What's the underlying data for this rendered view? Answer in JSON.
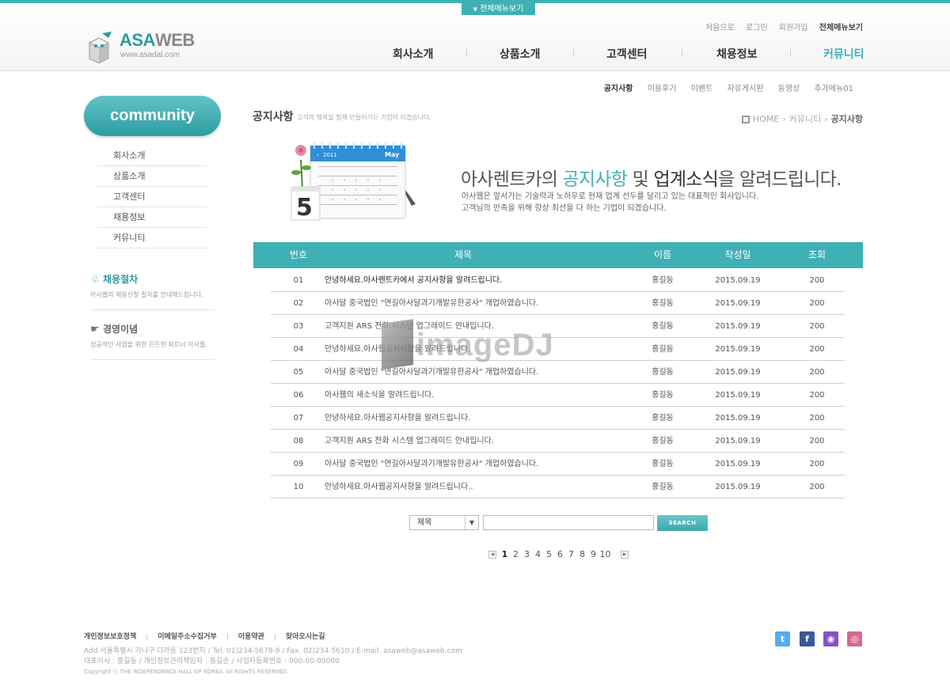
{
  "header": {
    "all_menu_tab": "전체메뉴보기",
    "logo": {
      "name_a": "ASA",
      "name_b": "WEB",
      "url": "www.asadal.com"
    },
    "util_links": [
      "처음으로",
      "로그인",
      "회원가입",
      "전체메뉴보기"
    ],
    "gnb": [
      "회사소개",
      "상품소개",
      "고객센터",
      "채용정보",
      "커뮤니티"
    ],
    "subnav": [
      "공지사항",
      "이용후기",
      "이벤트",
      "자유게시판",
      "동영상",
      "추가메뉴01"
    ]
  },
  "sidebar": {
    "badge": "community",
    "items": [
      "회사소개",
      "상품소개",
      "고객센터",
      "채용정보",
      "커뮤니티"
    ],
    "box1": {
      "title": "채용절차",
      "desc": "아사웹의 채용신청 절차를 안내해드립니다."
    },
    "box2": {
      "title": "경영이념",
      "desc": "성공적인 사업을 위한 든든한 파트너 아사웹."
    }
  },
  "content": {
    "page_title": "공지사항",
    "page_subtitle": "고객의 행복을 함께 만들어가는 기업이 되겠습니다.",
    "breadcrumb": {
      "home": "HOME",
      "section": "커뮤니티",
      "current": "공지사항"
    },
    "calendar": {
      "month": "May",
      "year": "2011",
      "day": "5"
    },
    "headline": {
      "a": "아사렌트카의 ",
      "b": "공지사항",
      "c": " 및 ",
      "d": "업계소식",
      "e": "을 알려드립니다."
    },
    "desc_lines": [
      "아사웹은 앞서가는 기술력과 노하우로 현재 업계 선두를 달리고 있는 대표적인 회사입니다.",
      "고객님의 만족을 위해 항상 최선을 다 하는 기업이 되겠습니다."
    ],
    "columns": [
      "번호",
      "제목",
      "이름",
      "작성일",
      "조회"
    ],
    "rows": [
      {
        "num": "01",
        "title": "안녕하세요.아사렌트카에서 공지사항을 알려드립니다.",
        "name": "홍길동",
        "date": "2015.09.19",
        "hits": "200"
      },
      {
        "num": "02",
        "title": "아사달 중국법인 \"연길아사달과기개발유한공사\" 개업하였습니다.",
        "name": "홍길동",
        "date": "2015.09.19",
        "hits": "200"
      },
      {
        "num": "03",
        "title": "고객지원 ARS 전화 시스템 업그레이드 안내입니다.",
        "name": "홍길동",
        "date": "2015.09.19",
        "hits": "200"
      },
      {
        "num": "04",
        "title": "안녕하세요.아사웹공지사항을 알려드립니다.",
        "name": "홍길동",
        "date": "2015.09.19",
        "hits": "200"
      },
      {
        "num": "05",
        "title": "아사달 중국법인 \"연길아사달과기개발유한공사\" 개업하였습니다.",
        "name": "홍길동",
        "date": "2015.09.19",
        "hits": "200"
      },
      {
        "num": "06",
        "title": "아사웹의 새소식을 알려드립니다.",
        "name": "홍길동",
        "date": "2015.09.19",
        "hits": "200"
      },
      {
        "num": "07",
        "title": "안녕하세요.아사웹공지사항을 알려드립니다.",
        "name": "홍길동",
        "date": "2015.09.19",
        "hits": "200"
      },
      {
        "num": "08",
        "title": "고객지원 ARS 전화 시스템 업그레이드 안내입니다.",
        "name": "홍길동",
        "date": "2015.09.19",
        "hits": "200"
      },
      {
        "num": "09",
        "title": "아사달 중국법인 \"연길아사달과기개발유한공사\" 개업하였습니다.",
        "name": "홍길동",
        "date": "2015.09.19",
        "hits": "200"
      },
      {
        "num": "10",
        "title": "안녕하세요.아사웹공지사항을 알려드립니다..",
        "name": "홍길동",
        "date": "2015.09.19",
        "hits": "200"
      }
    ],
    "watermark": "imageDJ",
    "search": {
      "select_value": "제목",
      "input_value": "",
      "button": "SEARCH"
    },
    "pages": [
      "1",
      "2",
      "3",
      "4",
      "5",
      "6",
      "7",
      "8",
      "9",
      "10"
    ],
    "current_page": "1"
  },
  "footer": {
    "links": [
      "개인정보보호정책",
      "이메일주소수집거부",
      "이용약관",
      "찾아오시는길"
    ],
    "info_lines": [
      "Add.서울특별시 가나구 다라동 123번지  / Tel. 01)234-5678-9  / Fax. 02)234-5610  / E-mail. asaweb@asaweb.com",
      "대표이사 : 홍길동 / 개인정보관리책임자 : 홍길순 / 사업자등록번호 : 000-00-00000"
    ],
    "copyright": "Copyright ⓒ THE INDEPENDENCE HALL OF KOREA. All RIGHTS RESERVED.",
    "sns": [
      {
        "icon": "twitter-icon",
        "glyph": "t",
        "color": "#55acee"
      },
      {
        "icon": "facebook-icon",
        "glyph": "f",
        "color": "#3b5998"
      },
      {
        "icon": "podcast-icon",
        "glyph": "◉",
        "color": "#8a4fc7"
      },
      {
        "icon": "instagram-icon",
        "glyph": "◎",
        "color": "#d56b8c"
      }
    ]
  },
  "colors": {
    "accent": "#3fb0b5",
    "accent_dark": "#2d9ca2"
  }
}
